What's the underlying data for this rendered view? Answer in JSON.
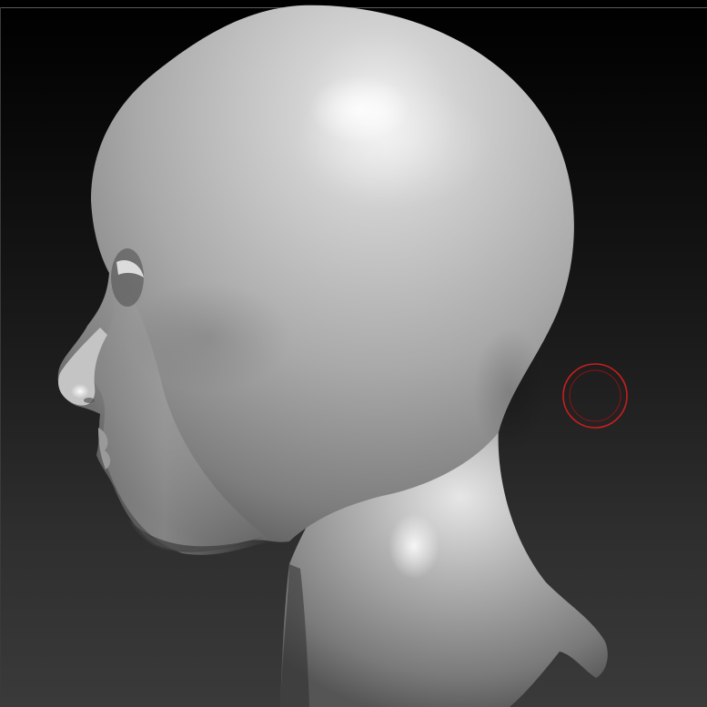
{
  "canvas": {
    "background_colors": [
      "#000000",
      "#1c1c1c",
      "#3a3a3a"
    ]
  },
  "model": {
    "subject": "bust-head-profile-left",
    "material_color": "#b8b8b8",
    "highlight_color": "#f2f2f2",
    "shadow_color": "#3c3c3c"
  },
  "brush": {
    "icon": "brush-circle-cursor-icon",
    "outer_color": "#c81e1e",
    "inner_color": "#8c1414"
  }
}
